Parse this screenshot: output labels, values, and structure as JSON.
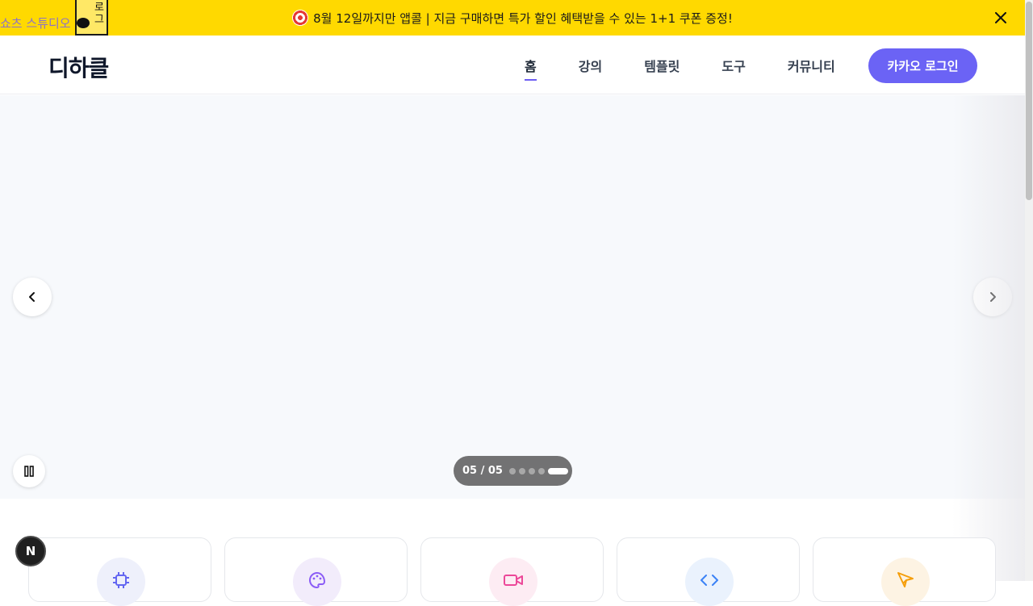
{
  "banner": {
    "text": "8월 12일까지만 앱콜 | 지금 구매하면 특가 할인 혜택받을 수 있는 1+1 쿠폰 증정!",
    "leftover_text": "쇼츠 스튜디오",
    "leftover_box_text": "로\n그"
  },
  "header": {
    "logo": "디하클",
    "nav": [
      {
        "label": "홈",
        "active": true
      },
      {
        "label": "강의",
        "active": false
      },
      {
        "label": "템플릿",
        "active": false
      },
      {
        "label": "도구",
        "active": false
      },
      {
        "label": "커뮤니티",
        "active": false
      }
    ],
    "login_label": "카카오 로그인"
  },
  "hero": {
    "current": "05",
    "total": "05",
    "counter": "05 / 05",
    "slide_count": 5,
    "active_slide": 5
  },
  "categories": [
    {
      "icon": "chip-icon",
      "color": "#6366f1",
      "bg": "#eef0fb"
    },
    {
      "icon": "palette-icon",
      "color": "#8b5cf6",
      "bg": "#f2ecfb"
    },
    {
      "icon": "video-icon",
      "color": "#ec4899",
      "bg": "#fdecf3"
    },
    {
      "icon": "code-icon",
      "color": "#3b82f6",
      "bg": "#eaf2fd"
    },
    {
      "icon": "send-icon",
      "color": "#f59e0b",
      "bg": "#fdf3e3"
    }
  ],
  "colors": {
    "banner_bg": "#FFD900",
    "accent": "#6B63F5"
  },
  "badge": "N"
}
